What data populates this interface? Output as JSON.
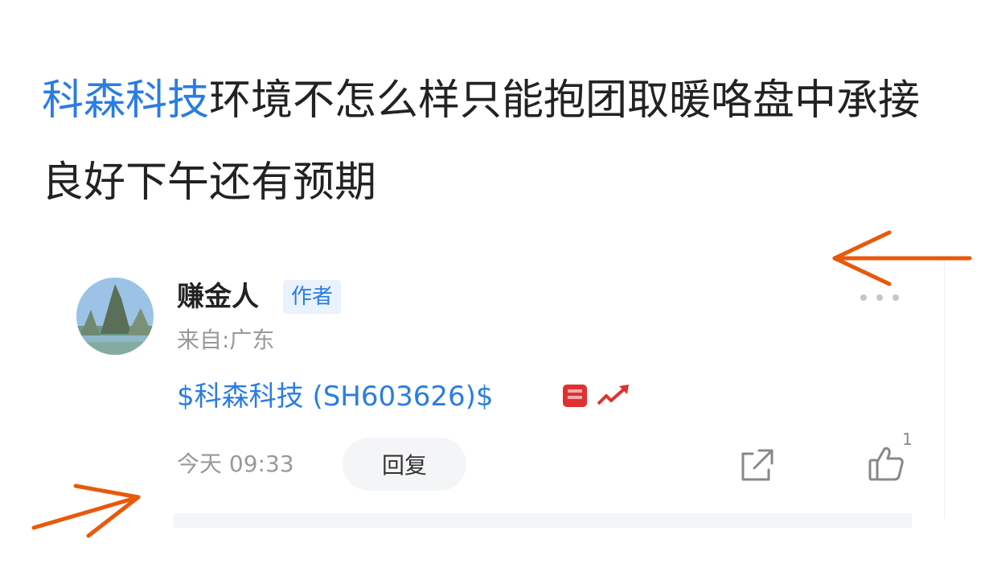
{
  "post": {
    "stock_name": "科森科技",
    "text_rest": "环境不怎么样只能抱团取暖咯盘中承接良好下午还有预期"
  },
  "comment": {
    "author": "赚金人",
    "badge": "作者",
    "location": "来自:广东",
    "stock_mention": "$科森科技 (SH603626)$",
    "time": "今天 09:33",
    "reply_label": "回复",
    "like_count": "1"
  },
  "icons": {
    "more": "more-dots-icon",
    "share": "share-icon",
    "like": "thumbs-up-icon",
    "emoji": "rising-emoji-icon"
  },
  "colors": {
    "link": "#2a7de1",
    "annotation_arrow": "#e8590c",
    "emoji_red": "#e03131"
  }
}
